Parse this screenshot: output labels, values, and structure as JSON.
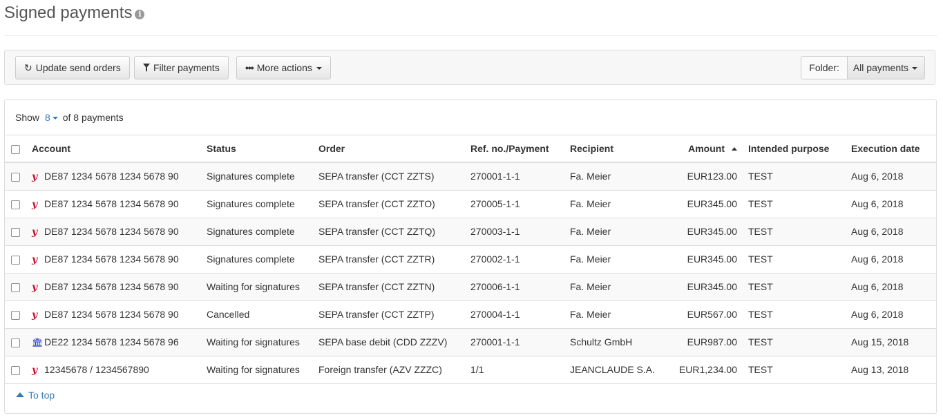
{
  "header": {
    "title": "Signed payments",
    "info_icon": "info-circle-icon"
  },
  "toolbar": {
    "update_label": "Update send orders",
    "filter_label": "Filter payments",
    "more_label": "More actions",
    "folder_label": "Folder:",
    "folder_value": "All payments"
  },
  "show": {
    "prefix": "Show",
    "count": "8",
    "suffix": "of 8 payments"
  },
  "table": {
    "columns": [
      "Account",
      "Status",
      "Order",
      "Ref. no./Payment",
      "Recipient",
      "Amount",
      "Intended purpose",
      "Execution date"
    ],
    "rows": [
      {
        "icon": "y",
        "account": "DE87 1234 5678 1234 5678 90",
        "status": "Signatures complete",
        "order": "SEPA transfer (CCT ZZTS)",
        "ref": "270001-1-1",
        "recipient": "Fa. Meier",
        "amount": "EUR123.00",
        "purpose": "TEST",
        "date": "Aug 6, 2018"
      },
      {
        "icon": "y",
        "account": "DE87 1234 5678 1234 5678 90",
        "status": "Signatures complete",
        "order": "SEPA transfer (CCT ZZTO)",
        "ref": "270005-1-1",
        "recipient": "Fa. Meier",
        "amount": "EUR345.00",
        "purpose": "TEST",
        "date": "Aug 6, 2018"
      },
      {
        "icon": "y",
        "account": "DE87 1234 5678 1234 5678 90",
        "status": "Signatures complete",
        "order": "SEPA transfer (CCT ZZTQ)",
        "ref": "270003-1-1",
        "recipient": "Fa. Meier",
        "amount": "EUR345.00",
        "purpose": "TEST",
        "date": "Aug 6, 2018"
      },
      {
        "icon": "y",
        "account": "DE87 1234 5678 1234 5678 90",
        "status": "Signatures complete",
        "order": "SEPA transfer (CCT ZZTR)",
        "ref": "270002-1-1",
        "recipient": "Fa. Meier",
        "amount": "EUR345.00",
        "purpose": "TEST",
        "date": "Aug 6, 2018"
      },
      {
        "icon": "y",
        "account": "DE87 1234 5678 1234 5678 90",
        "status": "Waiting for signatures",
        "order": "SEPA transfer (CCT ZZTN)",
        "ref": "270006-1-1",
        "recipient": "Fa. Meier",
        "amount": "EUR345.00",
        "purpose": "TEST",
        "date": "Aug 6, 2018"
      },
      {
        "icon": "y",
        "account": "DE87 1234 5678 1234 5678 90",
        "status": "Cancelled",
        "order": "SEPA transfer (CCT ZZTP)",
        "ref": "270004-1-1",
        "recipient": "Fa. Meier",
        "amount": "EUR567.00",
        "purpose": "TEST",
        "date": "Aug 6, 2018"
      },
      {
        "icon": "bank",
        "account": "DE22 1234 5678 1234 5678 96",
        "status": "Waiting for signatures",
        "order": "SEPA base debit (CDD ZZZV)",
        "ref": "270001-1-1",
        "recipient": "Schultz GmbH",
        "amount": "EUR987.00",
        "purpose": "TEST",
        "date": "Aug 15, 2018"
      },
      {
        "icon": "y",
        "account": "12345678 / 1234567890",
        "status": "Waiting for signatures",
        "order": "Foreign transfer (AZV ZZZC)",
        "ref": "1/1",
        "recipient": "JEANCLAUDE S.A.",
        "amount": "EUR1,234.00",
        "purpose": "TEST",
        "date": "Aug 13, 2018"
      }
    ]
  },
  "footer": {
    "to_top": "To top"
  },
  "colors": {
    "link": "#337ab7",
    "bank_icon": "#1a37c9",
    "y_icon": "#c8102e"
  }
}
